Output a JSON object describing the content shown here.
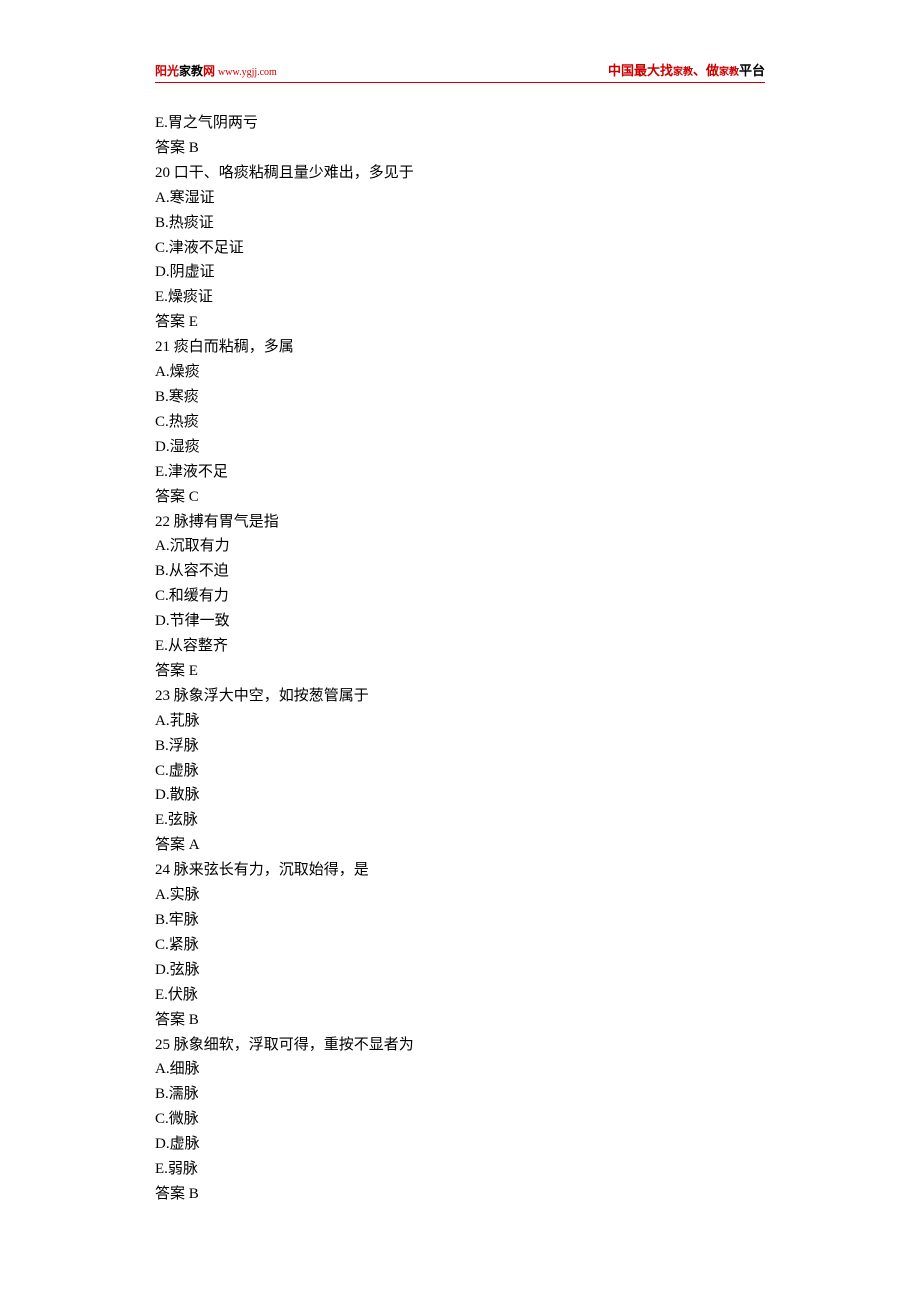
{
  "header": {
    "brand_part1": "阳光",
    "brand_part2": "家教",
    "brand_part3": "网",
    "url": "www.ygjj.com",
    "right_p1": "中国最大找",
    "right_small1": "家教",
    "right_p2": "、做",
    "right_small2": "家教",
    "right_p3": "平台"
  },
  "lines": [
    "E.胃之气阴两亏",
    "答案 B",
    "20 口干、咯痰粘稠且量少难出，多见于",
    "A.寒湿证",
    "B.热痰证",
    "C.津液不足证",
    "D.阴虚证",
    "E.燥痰证",
    "答案 E",
    "21 痰白而粘稠，多属",
    "A.燥痰",
    "B.寒痰",
    "C.热痰",
    "D.湿痰",
    "E.津液不足",
    "答案 C",
    "22 脉搏有胃气是指",
    "A.沉取有力",
    "B.从容不迫",
    "C.和缓有力",
    "D.节律一致",
    "E.从容整齐",
    "答案 E",
    "23 脉象浮大中空，如按葱管属于",
    "A.芤脉",
    "B.浮脉",
    "C.虚脉",
    "D.散脉",
    "E.弦脉",
    "答案 A",
    "24 脉来弦长有力，沉取始得，是",
    "A.实脉",
    "B.牢脉",
    "C.紧脉",
    "D.弦脉",
    "E.伏脉",
    "答案 B",
    "25 脉象细软，浮取可得，重按不显者为",
    "A.细脉",
    "B.濡脉",
    "C.微脉",
    "D.虚脉",
    "E.弱脉",
    "答案 B"
  ]
}
